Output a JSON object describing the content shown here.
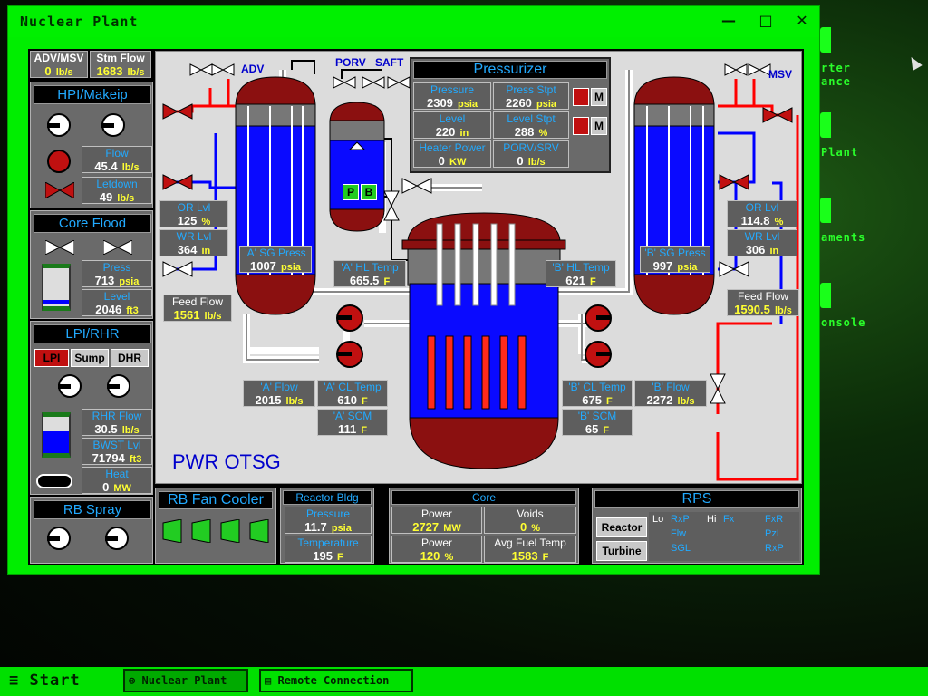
{
  "window": {
    "title": "Nuclear Plant"
  },
  "desktop": {
    "labels": [
      "rter",
      "ance",
      "Plant",
      "aments",
      "onsole"
    ]
  },
  "left": {
    "adv_msv": {
      "label": "ADV/MSV",
      "value": "0",
      "unit": "lb/s"
    },
    "stm_flow": {
      "label": "Stm Flow",
      "value": "1683",
      "unit": "lb/s"
    },
    "hpi": {
      "title": "HPI/Makeip",
      "flow_label": "Flow",
      "flow_value": "45.4",
      "flow_unit": "lb/s",
      "letdown_label": "Letdown",
      "letdown_value": "49",
      "letdown_unit": "lb/s"
    },
    "core_flood": {
      "title": "Core Flood",
      "press_label": "Press",
      "press_value": "713",
      "press_unit": "psia",
      "level_label": "Level",
      "level_value": "2046",
      "level_unit": "ft3"
    },
    "lpi": {
      "title": "LPI/RHR",
      "btn_lpi": "LPI",
      "btn_sump": "Sump",
      "btn_dhr": "DHR",
      "rhr_label": "RHR Flow",
      "rhr_value": "30.5",
      "rhr_unit": "lb/s",
      "bwst_label": "BWST Lvl",
      "bwst_value": "71794",
      "bwst_unit": "ft3",
      "heat_label": "Heat",
      "heat_value": "0",
      "heat_unit": "MW"
    },
    "rb_spray": {
      "title": "RB Spray"
    }
  },
  "schematic": {
    "adv": "ADV",
    "msv": "MSV",
    "porv": "PORV",
    "saft": "SAFT",
    "title": "PWR OTSG",
    "pzr_p": "P",
    "pzr_b": "B",
    "pressurizer": {
      "title": "Pressurizer",
      "pressure_label": "Pressure",
      "pressure_value": "2309",
      "pressure_unit": "psia",
      "stpt_label": "Press Stpt",
      "stpt_value": "2260",
      "stpt_unit": "psia",
      "level_label": "Level",
      "level_value": "220",
      "level_unit": "in",
      "lvlstpt_label": "Level Stpt",
      "lvlstpt_value": "288",
      "lvlstpt_unit": "%",
      "heater_label": "Heater Power",
      "heater_value": "0",
      "heater_unit": "KW",
      "porv_label": "PORV/SRV",
      "porv_value": "0",
      "porv_unit": "lb/s",
      "btn_m": "M"
    },
    "sg_a": {
      "or_label": "OR Lvl",
      "or_value": "125",
      "or_unit": "%",
      "wr_label": "WR Lvl",
      "wr_value": "364",
      "wr_unit": "in",
      "press_label": "'A' SG Press",
      "press_value": "1007",
      "press_unit": "psia",
      "feed_label": "Feed Flow",
      "feed_value": "1561",
      "feed_unit": "lb/s",
      "hl_label": "'A' HL Temp",
      "hl_value": "665.5",
      "hl_unit": "F",
      "flow_label": "'A' Flow",
      "flow_value": "2015",
      "flow_unit": "lb/s",
      "cl_label": "'A' CL Temp",
      "cl_value": "610",
      "cl_unit": "F",
      "scm_label": "'A' SCM",
      "scm_value": "111",
      "scm_unit": "F"
    },
    "sg_b": {
      "or_label": "OR Lvl",
      "or_value": "114.8",
      "or_unit": "%",
      "wr_label": "WR Lvl",
      "wr_value": "306",
      "wr_unit": "in",
      "press_label": "'B' SG Press",
      "press_value": "997",
      "press_unit": "psia",
      "feed_label": "Feed Flow",
      "feed_value": "1590.5",
      "feed_unit": "lb/s",
      "hl_label": "'B' HL Temp",
      "hl_value": "621",
      "hl_unit": "F",
      "flow_label": "'B' Flow",
      "flow_value": "2272",
      "flow_unit": "lb/s",
      "cl_label": "'B' CL Temp",
      "cl_value": "675",
      "cl_unit": "F",
      "scm_label": "'B' SCM",
      "scm_value": "65",
      "scm_unit": "F"
    }
  },
  "bottom": {
    "fan_cooler": {
      "title": "RB Fan Cooler"
    },
    "reactor_bldg": {
      "title": "Reactor Bldg",
      "pressure_label": "Pressure",
      "pressure_value": "11.7",
      "pressure_unit": "psia",
      "temp_label": "Temperature",
      "temp_value": "195",
      "temp_unit": "F"
    },
    "core": {
      "title": "Core",
      "power_label": "Power",
      "power_mw": "2727",
      "power_mw_unit": "MW",
      "voids_label": "Voids",
      "voids_value": "0",
      "voids_unit": "%",
      "power_pct_label": "Power",
      "power_pct": "120",
      "power_pct_unit": "%",
      "fuel_label": "Avg Fuel Temp",
      "fuel_value": "1583",
      "fuel_unit": "F"
    },
    "rps": {
      "title": "RPS",
      "reactor_btn": "Reactor",
      "turbine_btn": "Turbine",
      "lo": "Lo",
      "rxp": "RxP",
      "hi": "Hi",
      "fx": "Fx",
      "fxr": "FxR",
      "flw": "Flw",
      "pzl": "PzL",
      "sgl": "SGL",
      "rxp2": "RxP"
    }
  },
  "taskbar": {
    "start": "Start",
    "task1": "Nuclear Plant",
    "task2": "Remote Connection"
  },
  "colors": {
    "window_green": "#00ee00",
    "panel_gray": "#6a6a6a",
    "label_blue": "#22aaff",
    "value_yellow": "#ffff33",
    "vessel_red": "#8b1010"
  }
}
